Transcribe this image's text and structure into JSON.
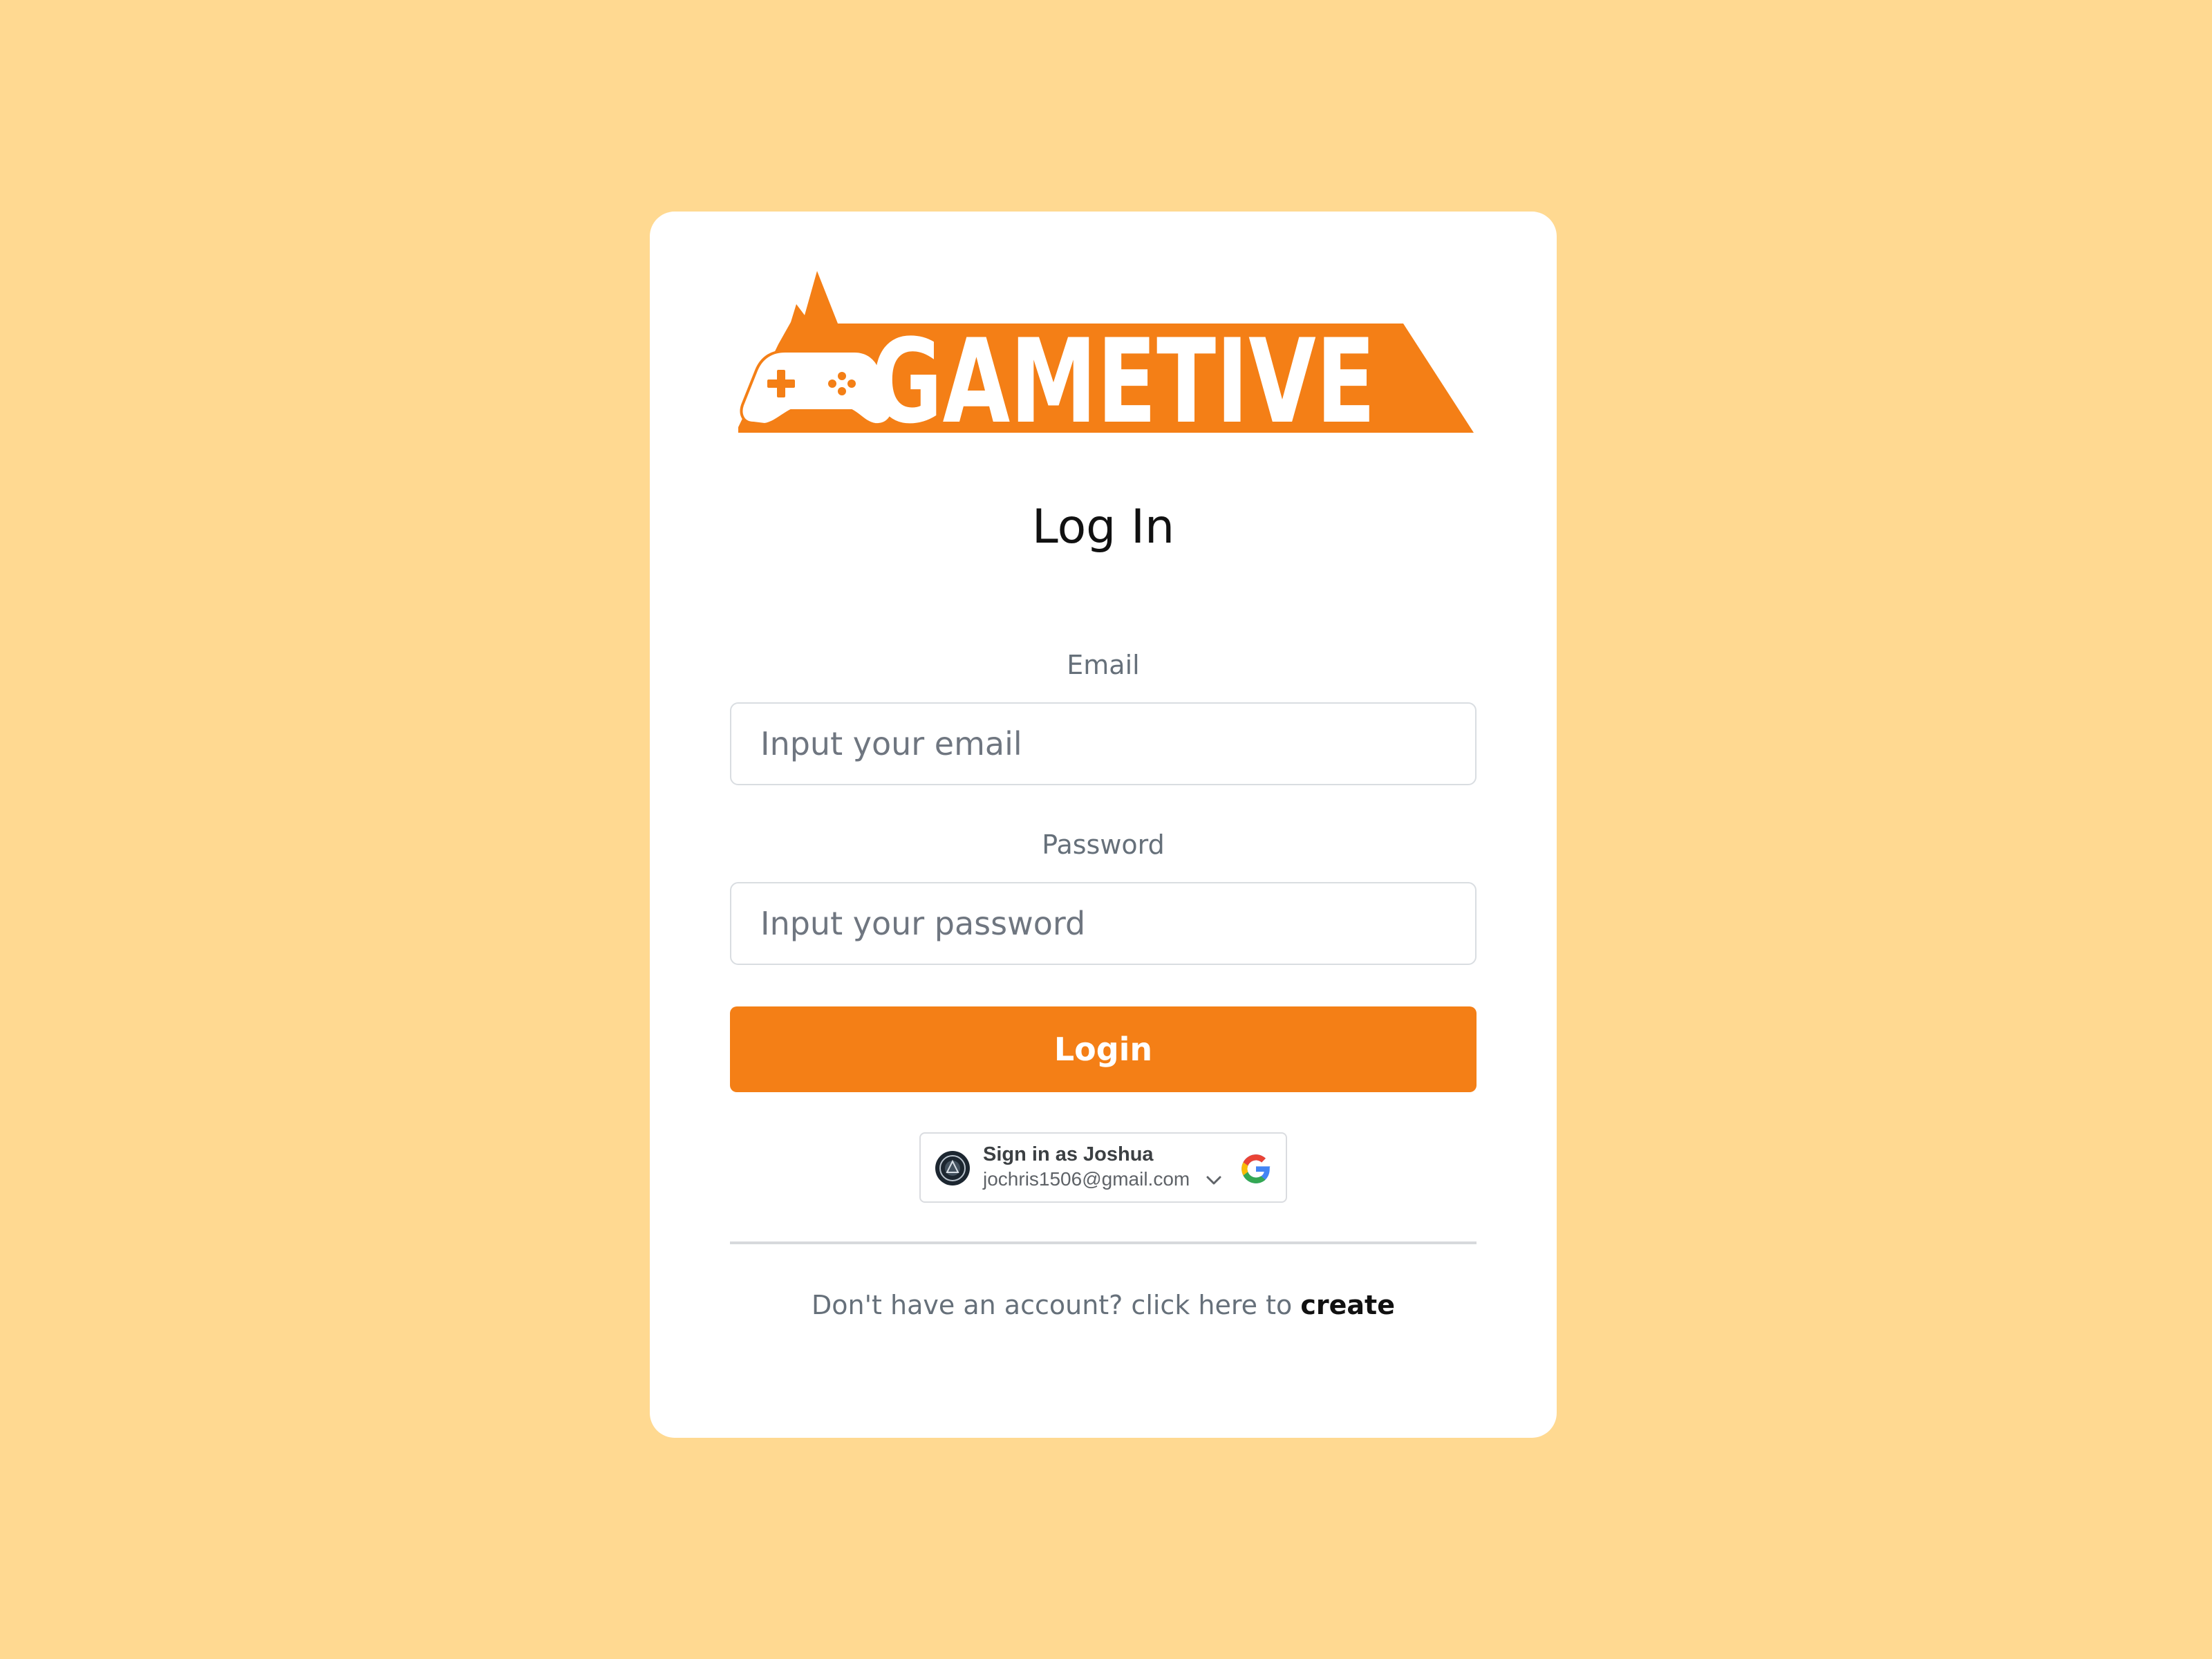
{
  "colors": {
    "background": "#FFD991",
    "accent": "#F47F16",
    "card": "#FFFFFF"
  },
  "logo": {
    "text": "GAMETIVE",
    "icon": "gamepad-icon"
  },
  "page_title": "Log In",
  "email": {
    "label": "Email",
    "placeholder": "Input your email",
    "value": ""
  },
  "password": {
    "label": "Password",
    "placeholder": "Input your password",
    "value": ""
  },
  "login_button": {
    "label": "Login"
  },
  "google_signin": {
    "title": "Sign in as Joshua",
    "email": "jochris1506@gmail.com",
    "icons": [
      "avatar-icon",
      "chevron-down-icon",
      "google-logo-icon"
    ]
  },
  "signup": {
    "prompt": "Don't have an account? click here to",
    "link_label": "create"
  }
}
